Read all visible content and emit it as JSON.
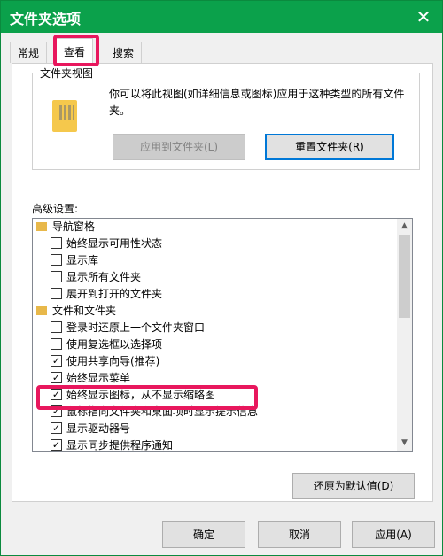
{
  "window": {
    "title": "文件夹选项",
    "close_glyph": "✕"
  },
  "tabs": [
    {
      "label": "常规"
    },
    {
      "label": "查看"
    },
    {
      "label": "搜索"
    }
  ],
  "folder_views": {
    "legend": "文件夹视图",
    "description": "你可以将此视图(如详细信息或图标)应用于这种类型的所有文件夹。",
    "apply_button": "应用到文件夹(L)",
    "reset_button": "重置文件夹(R)"
  },
  "advanced": {
    "label": "高级设置:",
    "items": [
      {
        "type": "group",
        "label": "导航窗格"
      },
      {
        "type": "check",
        "checked": false,
        "label": "始终显示可用性状态"
      },
      {
        "type": "check",
        "checked": false,
        "label": "显示库"
      },
      {
        "type": "check",
        "checked": false,
        "label": "显示所有文件夹"
      },
      {
        "type": "check",
        "checked": false,
        "label": "展开到打开的文件夹"
      },
      {
        "type": "group",
        "label": "文件和文件夹"
      },
      {
        "type": "check",
        "checked": false,
        "label": "登录时还原上一个文件夹窗口"
      },
      {
        "type": "check",
        "checked": false,
        "label": "使用复选框以选择项"
      },
      {
        "type": "check",
        "checked": true,
        "label": "使用共享向导(推荐)"
      },
      {
        "type": "check",
        "checked": true,
        "label": "始终显示菜单"
      },
      {
        "type": "check",
        "checked": true,
        "label": "始终显示图标，从不显示缩略图"
      },
      {
        "type": "check",
        "checked": true,
        "label": "鼠标指向文件夹和桌面项时显示提示信息"
      },
      {
        "type": "check",
        "checked": true,
        "label": "显示驱动器号"
      },
      {
        "type": "check",
        "checked": true,
        "label": "显示同步提供程序通知"
      }
    ],
    "restore_defaults": "还原为默认值(D)"
  },
  "footer": {
    "ok": "确定",
    "cancel": "取消",
    "apply": "应用(A)"
  },
  "colors": {
    "title_bar": "#0ba14b",
    "highlight": "#e8175d"
  }
}
